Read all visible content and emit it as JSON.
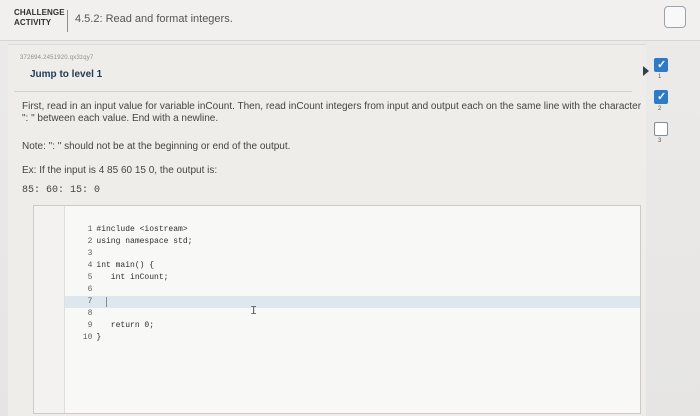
{
  "header": {
    "badge_line1": "CHALLENGE",
    "badge_line2": "ACTIVITY",
    "title": "4.5.2: Read and format integers."
  },
  "meta": {
    "id_text": "372694.2451920.qx3zqy7"
  },
  "content": {
    "jump_label": "Jump to level 1",
    "paragraph1": "First, read in an input value for variable inCount. Then, read inCount integers from input and output each on the same line with the character \": \" between each value. End with a newline.",
    "note": "Note: \": \" should not be at the beginning or end of the output.",
    "example": "Ex: If the input is 4 85 60 15 0, the output is:",
    "sample_output": "85: 60: 15: 0"
  },
  "editor": {
    "lines": [
      {
        "n": "1",
        "code": "#include <iostream>"
      },
      {
        "n": "2",
        "code": "using namespace std;"
      },
      {
        "n": "3",
        "code": ""
      },
      {
        "n": "4",
        "code": "int main() {"
      },
      {
        "n": "5",
        "code": "   int inCount;"
      },
      {
        "n": "6",
        "code": ""
      },
      {
        "n": "7",
        "code": ""
      },
      {
        "n": "8",
        "code": ""
      },
      {
        "n": "9",
        "code": "   return 0;"
      },
      {
        "n": "10",
        "code": "}"
      }
    ]
  },
  "levels": {
    "items": [
      {
        "label": "1",
        "completed": true
      },
      {
        "label": "2",
        "completed": true
      },
      {
        "label": "3",
        "completed": false
      }
    ]
  },
  "colors": {
    "accent": "#2d7bc8",
    "heading": "#1f3b56"
  },
  "icons": {
    "header_check": "checkbox-icon",
    "ibeam": "text-cursor-icon",
    "arrow": "arrow-right-icon"
  }
}
